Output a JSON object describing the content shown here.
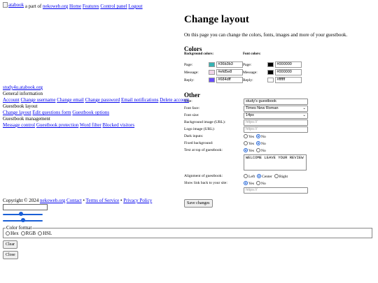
{
  "topbar": {
    "logo_alt": "atabook",
    "part_of_text": " a part of ",
    "nekoweb_link": "nekoweb.org",
    "links": [
      "Home",
      "Features",
      "Control panel",
      "Logout"
    ]
  },
  "sidebar": {
    "site_link": "study4u.atabook.org",
    "sections": [
      {
        "title": "General information",
        "links": [
          "Account",
          "Change username",
          "Change email",
          "Change password",
          "Email notifications",
          "Delete account"
        ]
      },
      {
        "title": "Guestbook layout",
        "links": [
          "Change layout",
          "Edit questions form",
          "Guestbook options"
        ]
      },
      {
        "title": "Guestbook management",
        "links": [
          "Message control",
          "Guestbook protection",
          "Word filter",
          "Blocked visitors"
        ]
      }
    ]
  },
  "main": {
    "title": "Change layout",
    "intro": "On this page you can change the colors, fonts, images and more of your guestbook.",
    "colors": {
      "heading": "Colors",
      "background": {
        "heading": "Background colors:",
        "rows": [
          {
            "label": "Page:",
            "value": "#36b3b3",
            "swatch": "#36b3b3"
          },
          {
            "label": "Message:",
            "value": "#efd5e8",
            "swatch": "#efd5e8"
          },
          {
            "label": "Reply:",
            "value": "#684dff",
            "swatch": "#684dff"
          }
        ]
      },
      "font": {
        "heading": "Font colors:",
        "rows": [
          {
            "label": "Page:",
            "value": "#000000",
            "swatch": "#000000"
          },
          {
            "label": "Message:",
            "value": "#000000",
            "swatch": "#000000"
          },
          {
            "label": "Reply:",
            "value": "#ffffff",
            "swatch": "#ffffff"
          }
        ]
      }
    },
    "other": {
      "heading": "Other",
      "title_label": "Title:",
      "title_value": "study's guestbook",
      "font_face_label": "Font face:",
      "font_face_value": "Times New Roman",
      "font_size_label": "Font size:",
      "font_size_value": "14px",
      "bg_image_label": "Background image (URL):",
      "bg_image_placeholder": "https://",
      "logo_image_label": "Logo image (URL):",
      "logo_image_placeholder": "https://",
      "dark_inputs_label": "Dark inputs:",
      "fixed_bg_label": "Fixed background:",
      "text_top_label": "Text at top of guestbook:",
      "text_top_value": "WELCOME LEAVE YOUR REVIEW",
      "alignment_label": "Alignment of guestbook:",
      "show_link_label": "Show link back to your site:",
      "link_placeholder": "https://",
      "yes": "Yes",
      "no": "No",
      "left": "Left",
      "center": "Center",
      "right": "Right",
      "save_label": "Save changes"
    }
  },
  "footer": {
    "copyright": "Copyright © 2024 ",
    "nekoweb": "nekoweb.org",
    "contact": "Contact",
    "sep": " • ",
    "terms": "Terms of Service",
    "privacy": "Privacy Policy"
  },
  "picker": {
    "slider1_level": 0.45,
    "slider2_level": 0.5,
    "format_legend": "Color format",
    "formats": [
      "Hex",
      "RGB",
      "HSL"
    ],
    "clear_label": "Clear",
    "close_label": "Close"
  },
  "colors": {
    "accent": "#1a5fd6",
    "link": "#0000ee"
  }
}
